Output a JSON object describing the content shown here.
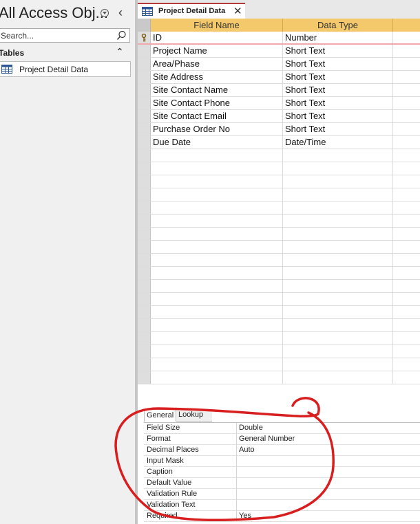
{
  "nav": {
    "title": "All Access Obj...",
    "search_placeholder": "Search...",
    "group_label": "Tables",
    "items": [
      {
        "label": "Project Detail Data"
      }
    ]
  },
  "doc_tab": {
    "label": "Project Detail Data"
  },
  "grid": {
    "headers": {
      "field_name": "Field Name",
      "data_type": "Data Type"
    },
    "rows": [
      {
        "field": "ID",
        "type": "Number"
      },
      {
        "field": "Project Name",
        "type": "Short Text"
      },
      {
        "field": "Area/Phase",
        "type": "Short Text"
      },
      {
        "field": "Site Address",
        "type": "Short Text"
      },
      {
        "field": "Site Contact Name",
        "type": "Short Text"
      },
      {
        "field": "Site Contact Phone",
        "type": "Short Text"
      },
      {
        "field": "Site Contact Email",
        "type": "Short Text"
      },
      {
        "field": "Purchase Order No",
        "type": "Short Text"
      },
      {
        "field": "Due Date",
        "type": "Date/Time"
      }
    ]
  },
  "properties": {
    "tabs": {
      "general": "General",
      "lookup": "Lookup"
    },
    "rows": [
      {
        "name": "Field Size",
        "value": "Double"
      },
      {
        "name": "Format",
        "value": "General Number"
      },
      {
        "name": "Decimal Places",
        "value": "Auto"
      },
      {
        "name": "Input Mask",
        "value": ""
      },
      {
        "name": "Caption",
        "value": ""
      },
      {
        "name": "Default Value",
        "value": ""
      },
      {
        "name": "Validation Rule",
        "value": ""
      },
      {
        "name": "Validation Text",
        "value": ""
      },
      {
        "name": "Required",
        "value": "Yes"
      }
    ]
  },
  "colors": {
    "header_gold": "#f3c96b",
    "tab_accent": "#b33a3a",
    "annotation_red": "#d81e1e"
  },
  "icons": {
    "nav_menu": "circle-chevron-down-icon",
    "collapse": "chevron-left-icon",
    "search": "search-icon",
    "table": "table-icon",
    "close": "close-icon",
    "primary_key": "key-icon"
  }
}
